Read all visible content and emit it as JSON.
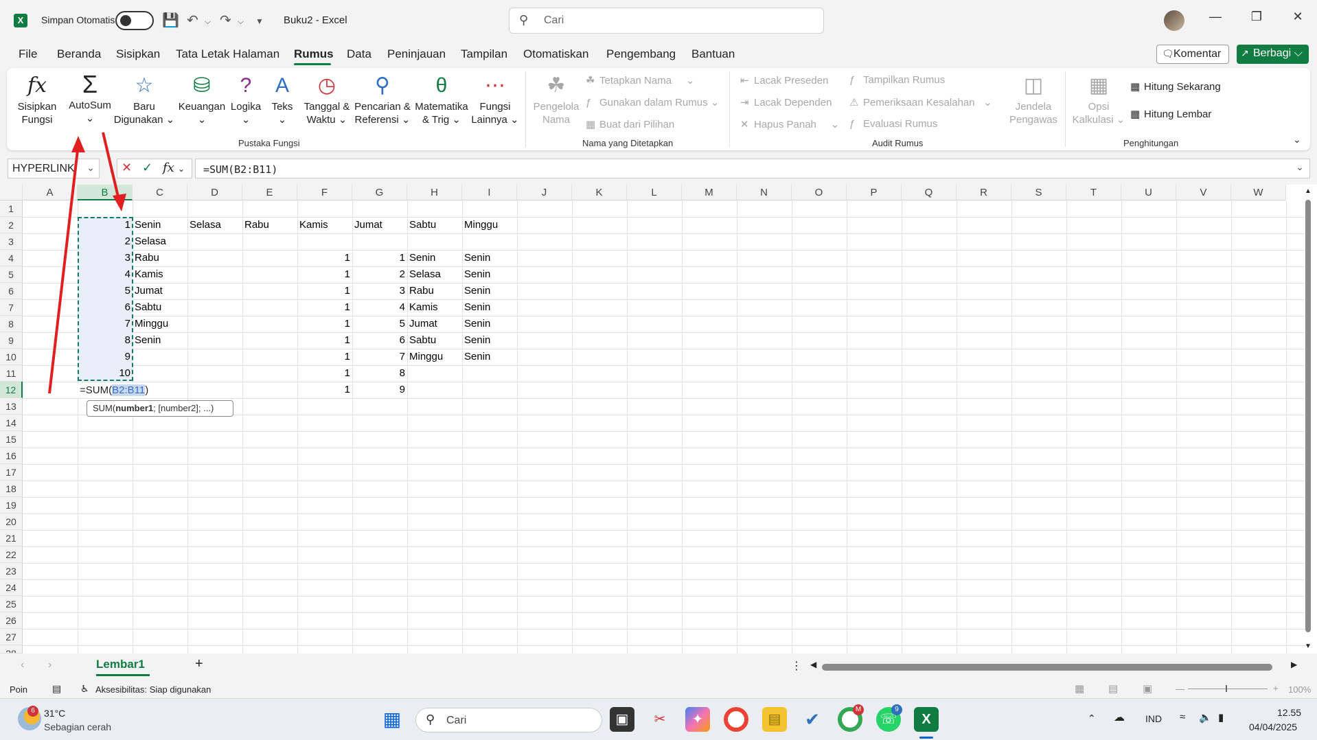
{
  "titlebar": {
    "autosave_label": "Simpan Otomatis",
    "doc_title": "Buku2  -  Excel",
    "search_placeholder": "Cari"
  },
  "menu": {
    "items": [
      "File",
      "Beranda",
      "Sisipkan",
      "Tata Letak Halaman",
      "Rumus",
      "Data",
      "Peninjauan",
      "Tampilan",
      "Otomatiskan",
      "Pengembang",
      "Bantuan"
    ],
    "active": "Rumus",
    "komentar": "Komentar",
    "berbagi": "Berbagi"
  },
  "ribbon": {
    "insert_fn": [
      "Sisipkan",
      "Fungsi"
    ],
    "autosum": "AutoSum",
    "recent": [
      "Baru",
      "Digunakan"
    ],
    "financial": "Keuangan",
    "logical": "Logika",
    "text": "Teks",
    "datetime": [
      "Tanggal &",
      "Waktu"
    ],
    "lookup": [
      "Pencarian &",
      "Referensi"
    ],
    "math": [
      "Matematika",
      "& Trig"
    ],
    "more": [
      "Fungsi",
      "Lainnya"
    ],
    "group_library": "Pustaka Fungsi",
    "name_manager": [
      "Pengelola",
      "Nama"
    ],
    "define_name": "Tetapkan Nama",
    "use_in_formula": "Gunakan dalam Rumus",
    "create_from_sel": "Buat dari Pilihan",
    "group_names": "Nama yang Ditetapkan",
    "trace_prec": "Lacak Preseden",
    "trace_dep": "Lacak Dependen",
    "remove_arrows": "Hapus Panah",
    "show_formulas": "Tampilkan Rumus",
    "error_check": "Pemeriksaan Kesalahan",
    "eval_formula": "Evaluasi Rumus",
    "watch_window": [
      "Jendela",
      "Pengawas"
    ],
    "group_audit": "Audit Rumus",
    "calc_options": [
      "Opsi",
      "Kalkulasi"
    ],
    "calc_now": "Hitung Sekarang",
    "calc_sheet": "Hitung Lembar",
    "group_calc": "Penghitungan"
  },
  "formula_bar": {
    "name_box": "HYPERLINK",
    "formula": "=SUM(B2:B11)"
  },
  "sheet": {
    "columns": [
      "A",
      "B",
      "C",
      "D",
      "E",
      "F",
      "G",
      "H",
      "I",
      "J",
      "K",
      "L",
      "M",
      "N",
      "O",
      "P",
      "Q",
      "R",
      "S",
      "T",
      "U",
      "V",
      "W"
    ],
    "rows": [
      "1",
      "2",
      "3",
      "4",
      "5",
      "6",
      "7",
      "8",
      "9",
      "10",
      "11",
      "12",
      "13",
      "14",
      "15",
      "16",
      "17",
      "18",
      "19",
      "20",
      "21",
      "22",
      "23",
      "24",
      "25",
      "26",
      "27",
      "28"
    ],
    "colB": [
      "1",
      "2",
      "3",
      "4",
      "5",
      "6",
      "7",
      "8",
      "9",
      "10"
    ],
    "colC": [
      "Senin",
      "Selasa",
      "Rabu",
      "Kamis",
      "Jumat",
      "Sabtu",
      "Minggu",
      "Senin"
    ],
    "row2_headers": [
      "Selasa",
      "Rabu",
      "Kamis",
      "Jumat",
      "Sabtu",
      "Minggu"
    ],
    "colF": [
      "1",
      "1",
      "1",
      "1",
      "1",
      "1",
      "1",
      "1",
      "1"
    ],
    "colG": [
      "1",
      "2",
      "3",
      "4",
      "5",
      "6",
      "7",
      "8",
      "9"
    ],
    "colH": [
      "Senin",
      "Selasa",
      "Rabu",
      "Kamis",
      "Jumat",
      "Sabtu",
      "Minggu"
    ],
    "colI": [
      "Senin",
      "Senin",
      "Senin",
      "Senin",
      "Senin",
      "Senin",
      "Senin"
    ],
    "edit_prefix": "=SUM(",
    "edit_ref": "B2:B11",
    "edit_suffix": ")",
    "tooltip_fn": "SUM(",
    "tooltip_arg1": "number1",
    "tooltip_rest": "; [number2]; ...)"
  },
  "sheetbar": {
    "tab": "Lembar1"
  },
  "status": {
    "mode": "Poin",
    "accessibility": "Aksesibilitas: Siap digunakan",
    "zoom": "100%"
  },
  "taskbar": {
    "temp": "31°C",
    "weather": "Sebagian cerah",
    "weather_badge": "6",
    "search": "Cari",
    "lang": "IND",
    "time": "12.55",
    "date": "04/04/2025",
    "whatsapp_badge": "9",
    "chrome_badge": "M"
  },
  "colors": {
    "accent": "#107c41",
    "arrow": "#e02020",
    "selection_border": "#117a65"
  }
}
